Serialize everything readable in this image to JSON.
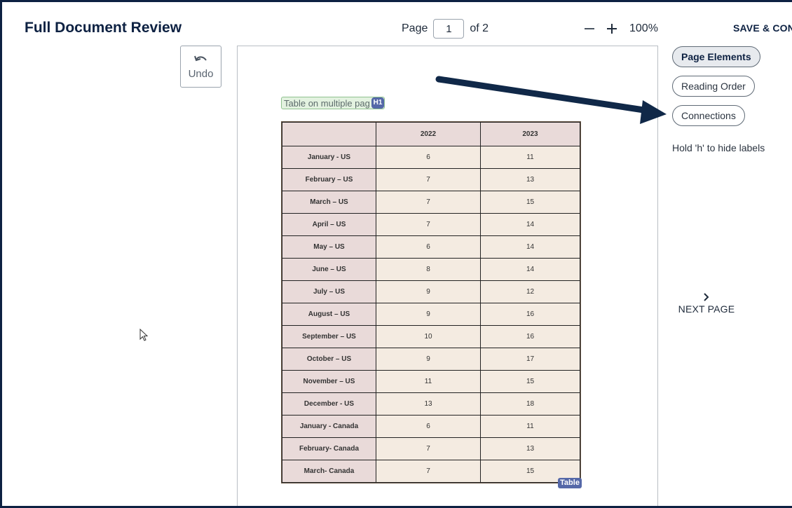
{
  "header": {
    "title": "Full Document Review",
    "page_label": "Page",
    "page_value": "1",
    "page_of": "of 2",
    "zoom_value": "100%",
    "save_label": "SAVE & CON"
  },
  "toolbar": {
    "undo_label": "Undo"
  },
  "document": {
    "heading_text": "Table on multiple pag",
    "heading_badge": "H1",
    "table_badge": "Table",
    "table": {
      "headers": [
        "",
        "2022",
        "2023"
      ],
      "rows": [
        [
          "January - US",
          "6",
          "11"
        ],
        [
          "February – US",
          "7",
          "13"
        ],
        [
          "March – US",
          "7",
          "15"
        ],
        [
          "April – US",
          "7",
          "14"
        ],
        [
          "May – US",
          "6",
          "14"
        ],
        [
          "June – US",
          "8",
          "14"
        ],
        [
          "July – US",
          "9",
          "12"
        ],
        [
          "August – US",
          "9",
          "16"
        ],
        [
          "September – US",
          "10",
          "16"
        ],
        [
          "October – US",
          "9",
          "17"
        ],
        [
          "November – US",
          "11",
          "15"
        ],
        [
          "December - US",
          "13",
          "18"
        ],
        [
          "January - Canada",
          "6",
          "11"
        ],
        [
          "February- Canada",
          "7",
          "13"
        ],
        [
          "March- Canada",
          "7",
          "15"
        ]
      ]
    }
  },
  "sidepanel": {
    "modes": [
      "Page Elements",
      "Reading Order",
      "Connections"
    ],
    "active_mode": "Page Elements",
    "hint": "Hold 'h' to hide labels",
    "next_label": "NEXT PAGE"
  },
  "colors": {
    "brand": "#0d2142",
    "badge": "#5568a8",
    "tag_bg": "#e3f2e0"
  }
}
